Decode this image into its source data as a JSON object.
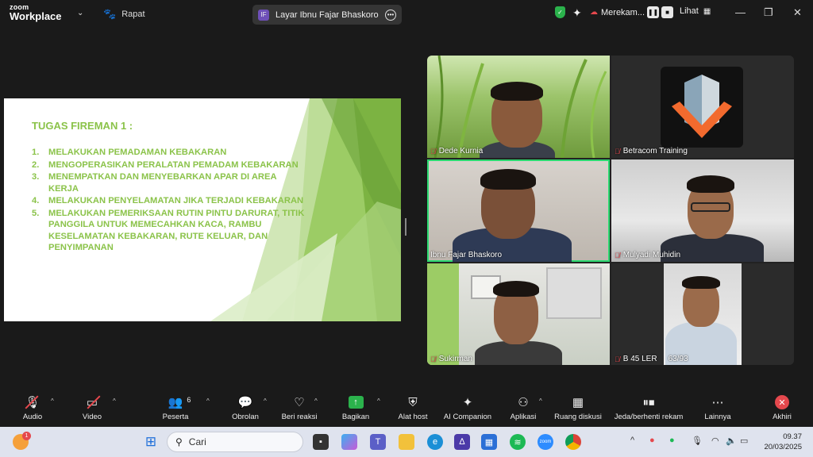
{
  "titlebar": {
    "logo_line1": "zoom",
    "logo_line2": "Workplace",
    "meeting_label": "Rapat",
    "share_badge": "IF",
    "share_label": "Layar Ibnu Fajar Bhaskoro",
    "recording_label": "Merekam...",
    "view_label": "Lihat"
  },
  "slide": {
    "title": "TUGAS FIREMAN 1 :",
    "items": [
      {
        "num": "1.",
        "text": "MELAKUKAN PEMADAMAN KEBAKARAN"
      },
      {
        "num": "2.",
        "text": "MENGOPERASIKAN PERALATAN PEMADAM KEBAKARAN"
      },
      {
        "num": "3.",
        "text": "MENEMPATKAN DAN MENYEBARKAN APAR DI AREA KERJA"
      },
      {
        "num": "4.",
        "text": "MELAKUKAN PENYELAMATAN JIKA TERJADI KEBAKARAN"
      },
      {
        "num": "5.",
        "text": "MELAKUKAN PEMERIKSAAN RUTIN PINTU DARURAT, TITIK PANGGILA UNTUK MEMECAHKAN KACA, RAMBU KESELAMATAN KEBAKARAN, RUTE KELUAR, DAN PENYIMPANAN"
      }
    ]
  },
  "participants": [
    {
      "name": "Dede Kurnia"
    },
    {
      "name": "Betracom Training"
    },
    {
      "name": "Ibnu Fajar Bhaskoro"
    },
    {
      "name": "Mulyadi Muhidin"
    },
    {
      "name": "Sukirman"
    },
    {
      "name": "B 45 LER",
      "extra": "63/93"
    }
  ],
  "toolbar": {
    "audio": "Audio",
    "video": "Video",
    "participants": "Peserta",
    "participants_count": "6",
    "chat": "Obrolan",
    "reactions": "Beri reaksi",
    "share": "Bagikan",
    "host_tools": "Alat host",
    "ai": "AI Companion",
    "apps": "Aplikasi",
    "breakout": "Ruang diskusi",
    "pause_record": "Jeda/berhenti rekam",
    "more": "Lainnya",
    "end": "Akhiri"
  },
  "taskbar": {
    "notification_count": "1",
    "search_placeholder": "Cari",
    "time": "09.37",
    "date": "20/03/2025"
  },
  "colors": {
    "slide_green": "#8bc34a",
    "active_speaker": "#2bd970",
    "muted_red": "#e5484d"
  }
}
